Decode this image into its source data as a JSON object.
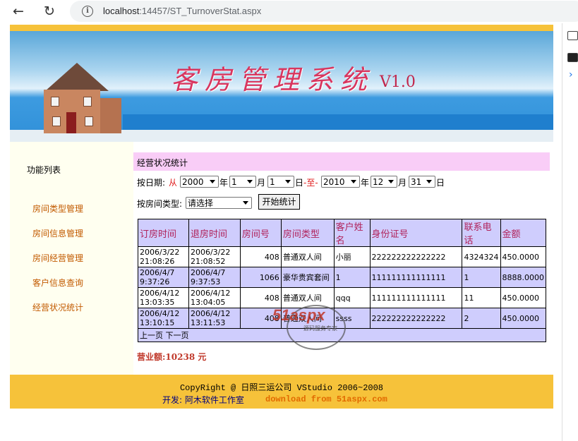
{
  "browser": {
    "url_host": "localhost",
    "url_path": ":14457/ST_TurnoverStat.aspx"
  },
  "banner": {
    "title": "客房管理系统",
    "version": "V1.0"
  },
  "sidebar": {
    "title": "功能列表",
    "items": [
      "房间类型管理",
      "房间信息管理",
      "房间经营管理",
      "客户信息查询",
      "经营状况统计"
    ]
  },
  "main": {
    "heading": "经营状况统计",
    "date_label": "按日期:",
    "from_label": "从",
    "from_year": "2000",
    "year_unit": "年",
    "from_month": "1",
    "month_unit": "月",
    "from_day": "1",
    "day_unit": "日",
    "to_label": "-至-",
    "to_year": "2010",
    "to_month": "12",
    "to_day": "31",
    "room_type_label": "按房间类型:",
    "room_type_select": "请选择",
    "start_button": "开始统计",
    "table": {
      "headers": [
        "订房时间",
        "退房时间",
        "房间号",
        "房间类型",
        "客户姓名",
        "身份证号",
        "联系电话",
        "金额"
      ],
      "rows": [
        [
          "2006/3/22 21:08:26",
          "2006/3/22 21:08:52",
          "408",
          "普通双人间",
          "小丽",
          "222222222222222",
          "4324324",
          "450.0000"
        ],
        [
          "2006/4/7 9:37:26",
          "2006/4/7 9:37:53",
          "1066",
          "豪华贵宾套间",
          "1",
          "111111111111111",
          "1",
          "8888.0000"
        ],
        [
          "2006/4/12 13:03:35",
          "2006/4/12 13:04:05",
          "408",
          "普通双人间",
          "qqq",
          "111111111111111",
          "11",
          "450.0000"
        ],
        [
          "2006/4/12 13:10:15",
          "2006/4/12 13:11:53",
          "408",
          "普通双人间",
          "ssss",
          "222222222222222",
          "2",
          "450.0000"
        ]
      ],
      "pager": "上一页 下一页"
    },
    "total": "营业额:10238 元"
  },
  "footer": {
    "line1": "CopyRight @ 日照三运公司 VStudio 2006~2008",
    "dev_label": "开发:",
    "dev_name": "阿木软件工作室",
    "download": "download from 51aspx.com"
  },
  "watermark": {
    "brand": "51aspx",
    "tagline": "源码服务专家"
  }
}
